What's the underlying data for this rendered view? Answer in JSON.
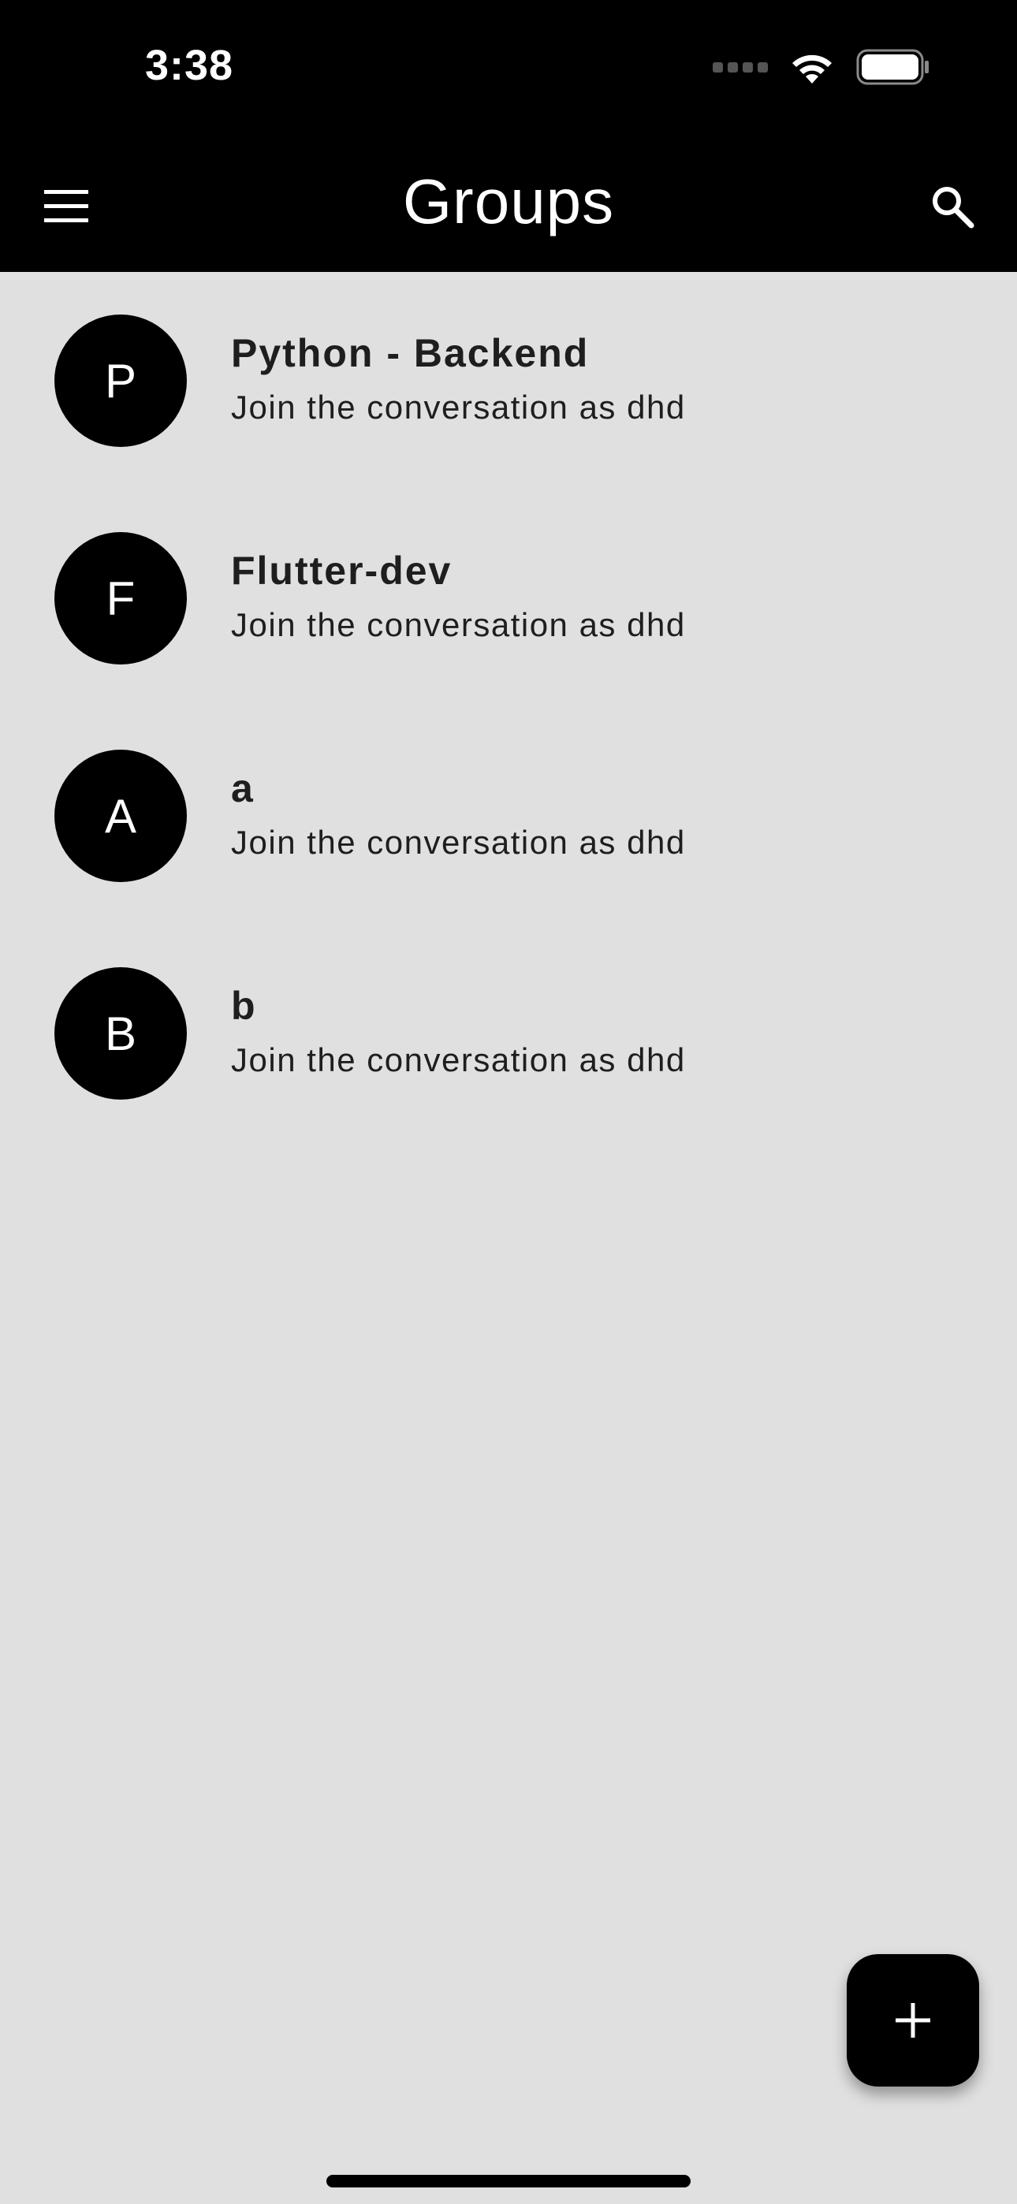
{
  "status_bar": {
    "time": "3:38",
    "icons": [
      "cellular-signal-icon",
      "wifi-icon",
      "battery-icon"
    ]
  },
  "app_bar": {
    "title": "Groups",
    "leading_icon": "menu-icon",
    "trailing_icon": "search-icon"
  },
  "groups": [
    {
      "initial": "P",
      "name": "Python - Backend",
      "subtitle": "Join the conversation as dhd"
    },
    {
      "initial": "F",
      "name": "Flutter-dev",
      "subtitle": "Join the conversation as dhd"
    },
    {
      "initial": "A",
      "name": "a",
      "subtitle": "Join the conversation as dhd"
    },
    {
      "initial": "B",
      "name": "b",
      "subtitle": "Join the conversation as dhd"
    }
  ],
  "fab": {
    "icon": "add-icon"
  },
  "colors": {
    "header_background": "#000000",
    "page_background": "#e0e0e0",
    "avatar_background": "#000000",
    "text_primary": "#1e1e1e"
  }
}
